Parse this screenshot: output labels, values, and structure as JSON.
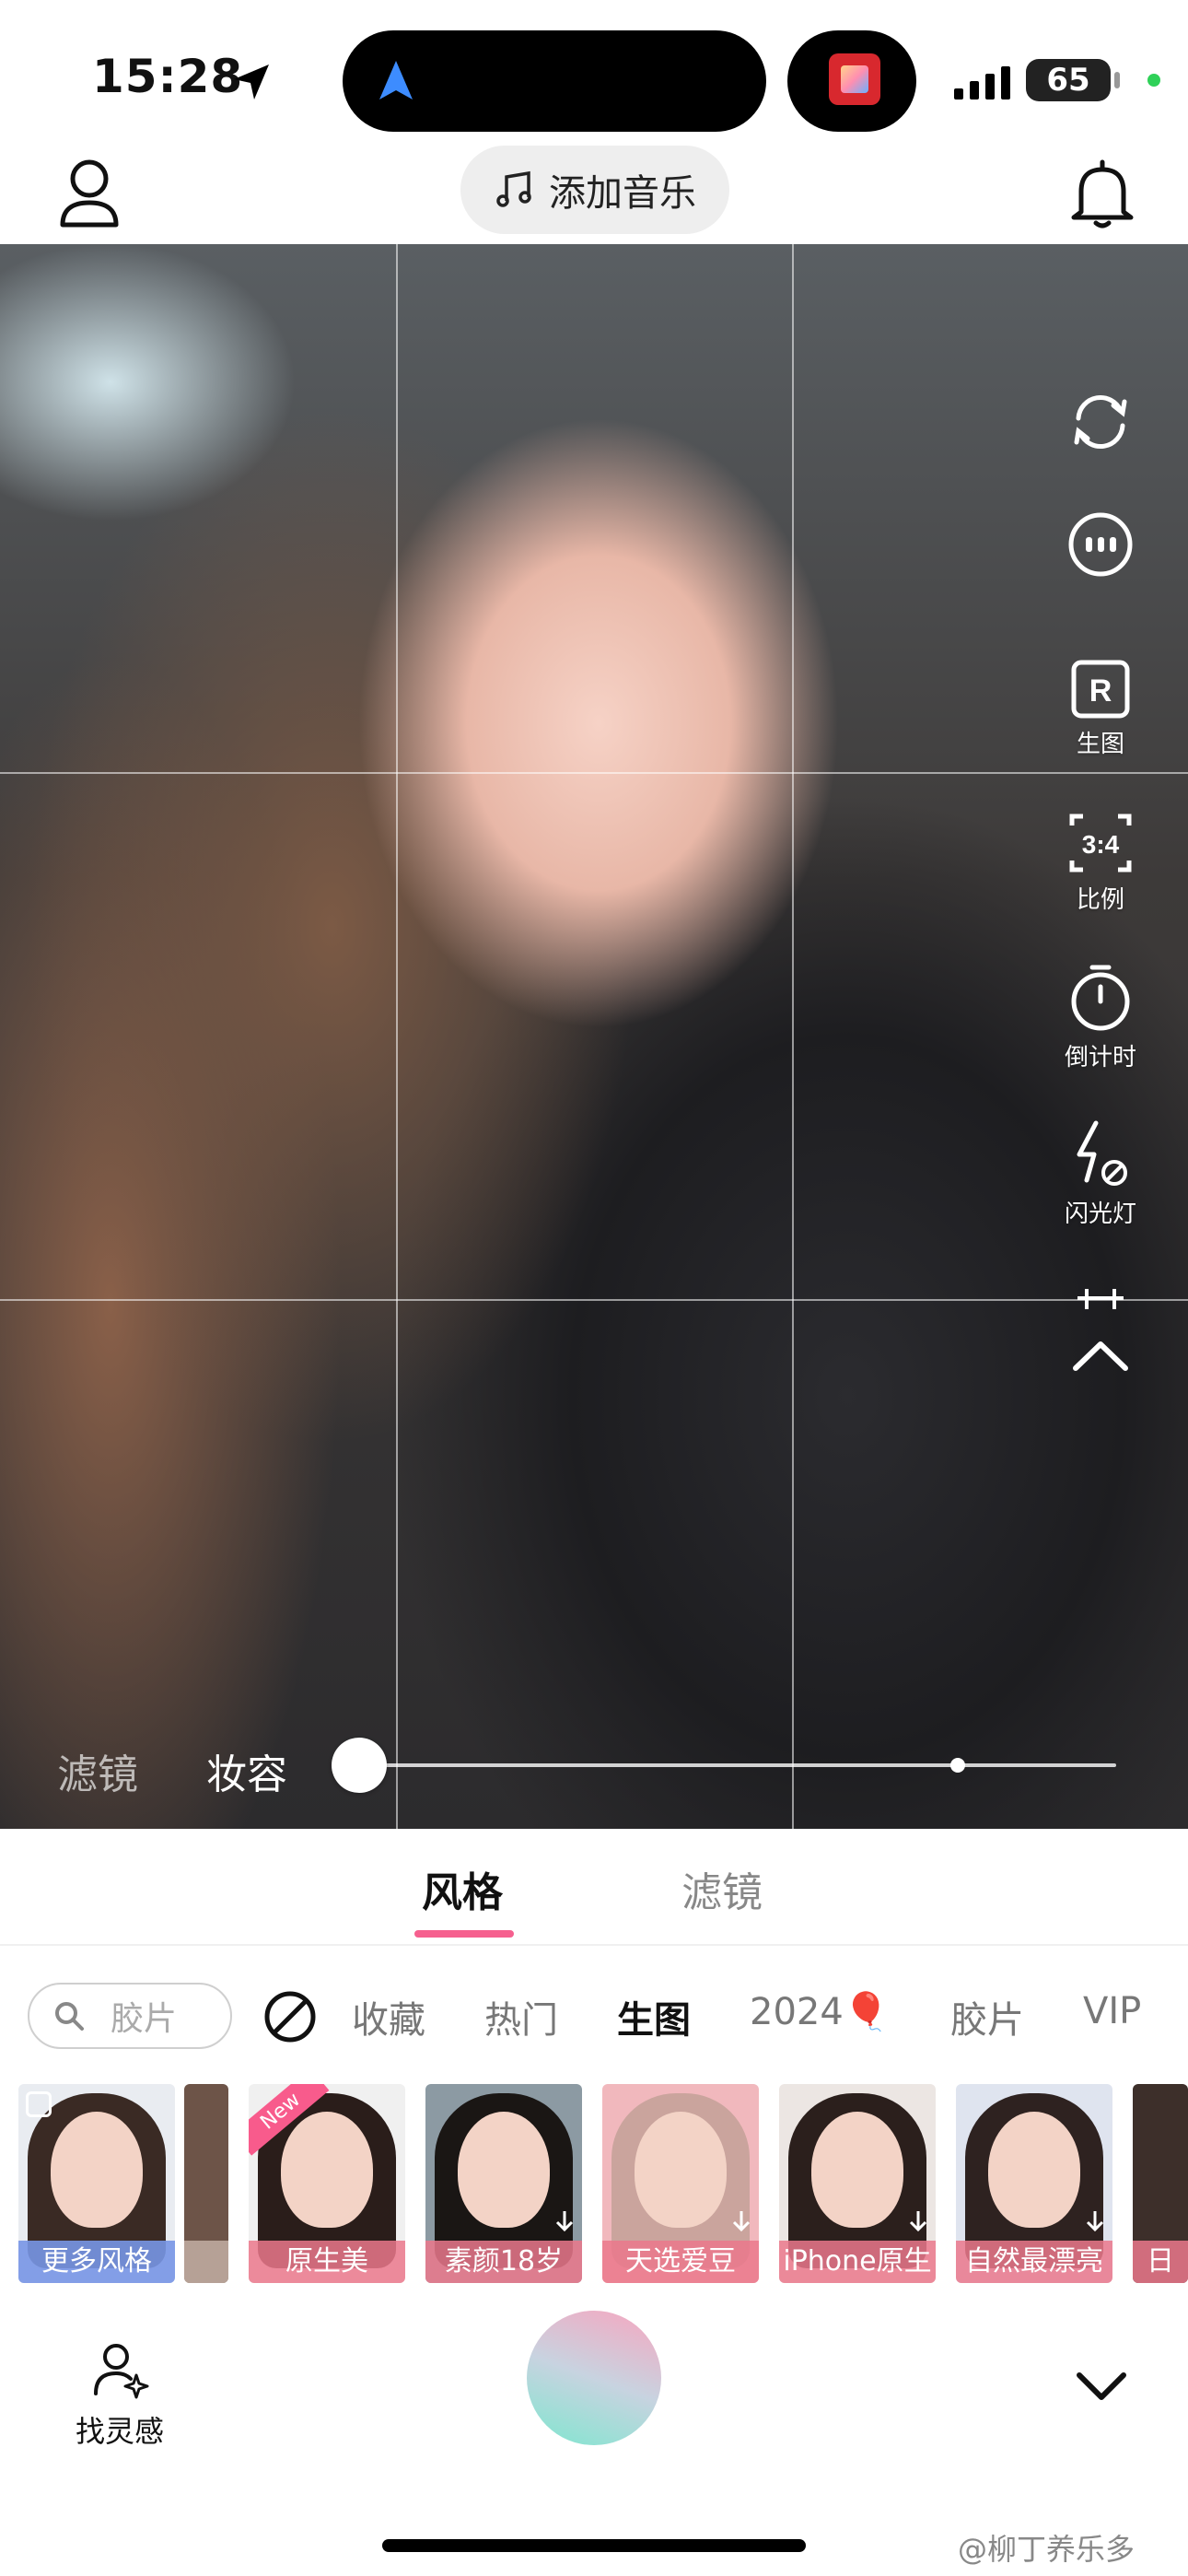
{
  "status_bar": {
    "time": "15:28",
    "battery": "65"
  },
  "top_bar": {
    "music_label": "添加音乐"
  },
  "right_tools": [
    {
      "icon": "flip-camera-icon",
      "label": ""
    },
    {
      "icon": "more-icon",
      "label": ""
    },
    {
      "icon": "raw-icon",
      "label": "生图",
      "icon_text": "R"
    },
    {
      "icon": "ratio-icon",
      "label": "比例",
      "icon_text": "3:4"
    },
    {
      "icon": "timer-icon",
      "label": "倒计时"
    },
    {
      "icon": "flash-off-icon",
      "label": "闪光灯"
    },
    {
      "icon": "collapse-icon",
      "label": ""
    }
  ],
  "slider": {
    "tab_filter": "滤镜",
    "tab_makeup": "妆容",
    "level": 0.0,
    "default_mark": 0.79
  },
  "panel": {
    "tabs": [
      "风格",
      "滤镜"
    ],
    "active_tab": "风格",
    "search_placeholder": "胶片",
    "categories": [
      "收藏",
      "热门",
      "生图",
      "2024🎈",
      "胶片",
      "VIP"
    ],
    "active_category": "生图",
    "thumbnails": [
      {
        "label": "更多风格",
        "style": "more"
      },
      {
        "label": "",
        "style": "partial"
      },
      {
        "label": "原生美",
        "badge": "New"
      },
      {
        "label": "素颜18岁"
      },
      {
        "label": "天选爱豆"
      },
      {
        "label": "iPhone原生"
      },
      {
        "label": "自然最漂亮"
      },
      {
        "label": "日"
      }
    ]
  },
  "bottom": {
    "inspire_label": "找灵感",
    "watermark": "@柳丁养乐多"
  },
  "colors": {
    "accent": "#f6608f",
    "thumb_label": "#eb788c",
    "shutter_start": "#f7a6bf",
    "shutter_end": "#7fe6cf"
  }
}
